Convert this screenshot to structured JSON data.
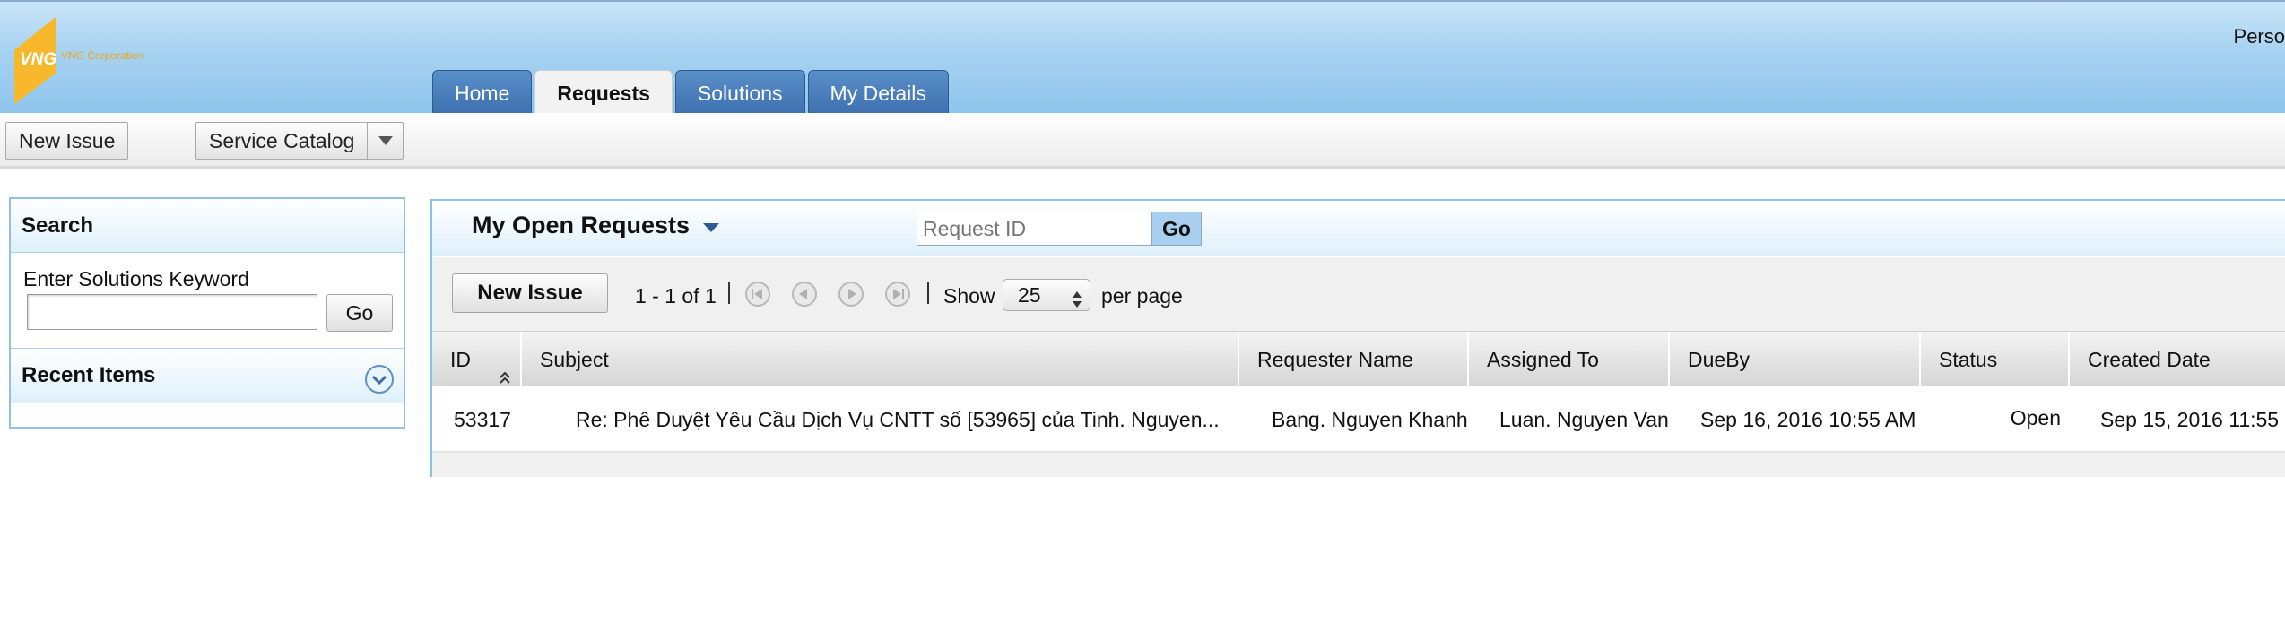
{
  "header": {
    "brand_mark": "VNG",
    "brand_tagline": "VNG Corporation",
    "right_text": "Perso"
  },
  "nav": {
    "tabs": [
      {
        "label": "Home",
        "active": false
      },
      {
        "label": "Requests",
        "active": true
      },
      {
        "label": "Solutions",
        "active": false
      },
      {
        "label": "My Details",
        "active": false
      }
    ]
  },
  "toolbar": {
    "new_issue_label": "New Issue",
    "service_catalog_label": "Service Catalog"
  },
  "search_panel": {
    "title": "Search",
    "keyword_label": "Enter Solutions Keyword",
    "keyword_value": "",
    "go_label": "Go",
    "recent_title": "Recent Items"
  },
  "requests": {
    "view_title": "My Open Requests",
    "request_id_placeholder": "Request ID",
    "go_label": "Go",
    "new_issue_label": "New Issue",
    "range_text": "1 - 1 of 1",
    "show_label": "Show",
    "page_size": "25",
    "per_page_label": "per page",
    "columns": [
      "ID",
      "Subject",
      "Requester Name",
      "Assigned To",
      "DueBy",
      "Status",
      "Created Date"
    ],
    "rows": [
      {
        "id": "53317",
        "subject": "Re: Phê Duyệt Yêu Cầu Dịch Vụ CNTT số [53965] của Tinh. Nguyen...",
        "requester": "Bang. Nguyen Khanh",
        "assigned_to": "Luan. Nguyen Van",
        "due_by": "Sep 16, 2016 10:55 AM",
        "status": "Open",
        "created_date": "Sep 15, 2016 11:55"
      }
    ]
  },
  "colors": {
    "header_top": "#c9e5f8",
    "header_bottom": "#8fc5ec",
    "tab_blue": "#3d70ae",
    "panel_border": "#8fc1e4",
    "logo_orange": "#f7b82b"
  }
}
